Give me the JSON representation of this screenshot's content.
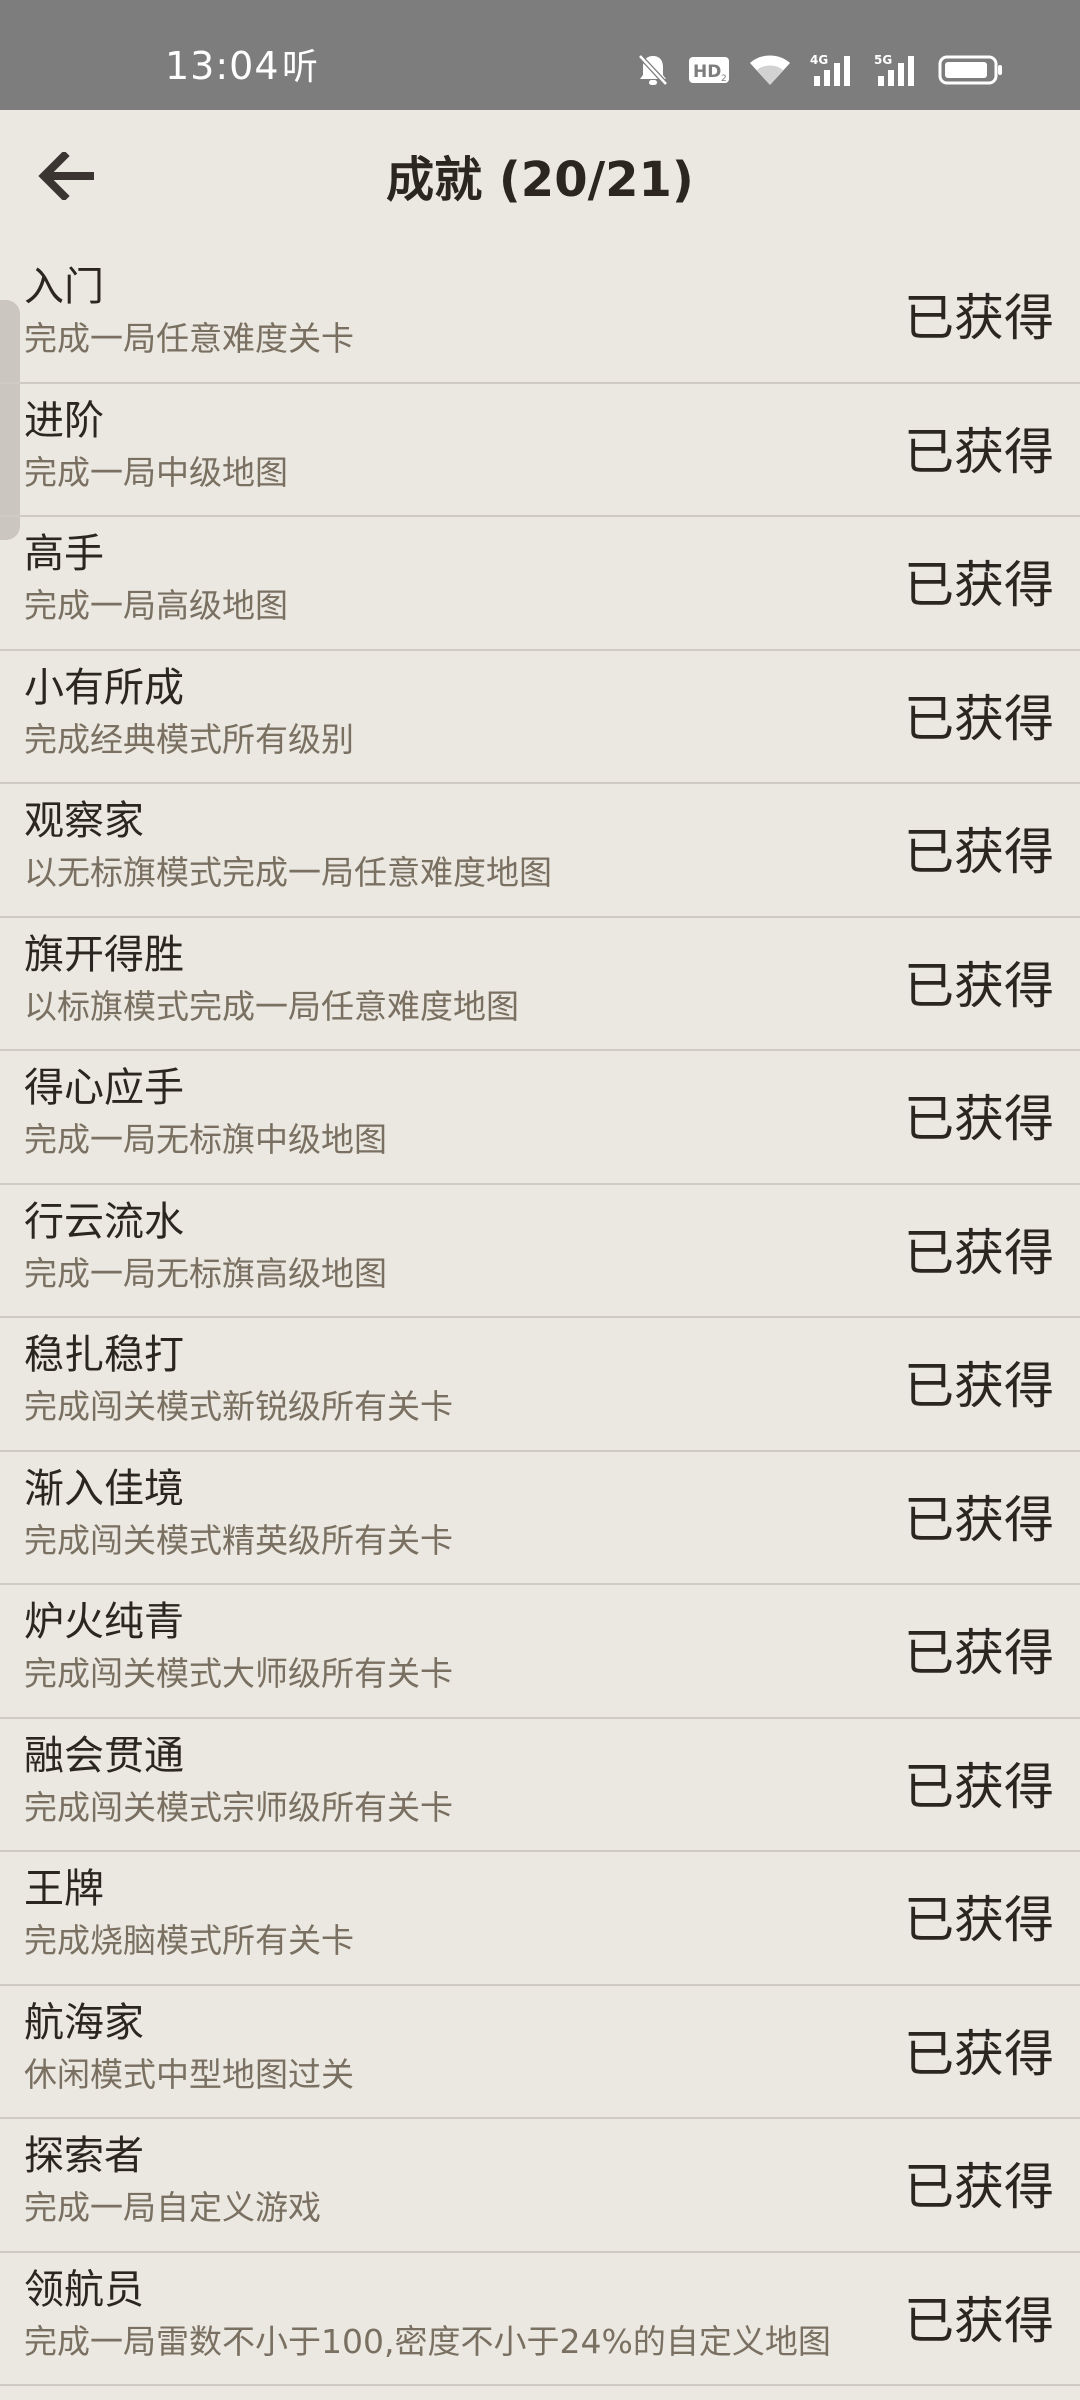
{
  "status_bar": {
    "time": "13:04",
    "extra": "听",
    "icons": [
      "bell-muted-icon",
      "hd-icon",
      "wifi-icon",
      "4g-signal-icon",
      "5g-signal-icon",
      "battery-icon"
    ]
  },
  "header": {
    "back_icon": "arrow-left-icon",
    "title": "成就 (20/21)"
  },
  "achievements": [
    {
      "name": "入门",
      "desc": "完成一局任意难度关卡",
      "status": "已获得"
    },
    {
      "name": "进阶",
      "desc": "完成一局中级地图",
      "status": "已获得"
    },
    {
      "name": "高手",
      "desc": "完成一局高级地图",
      "status": "已获得"
    },
    {
      "name": "小有所成",
      "desc": "完成经典模式所有级别",
      "status": "已获得"
    },
    {
      "name": "观察家",
      "desc": "以无标旗模式完成一局任意难度地图",
      "status": "已获得"
    },
    {
      "name": "旗开得胜",
      "desc": "以标旗模式完成一局任意难度地图",
      "status": "已获得"
    },
    {
      "name": "得心应手",
      "desc": "完成一局无标旗中级地图",
      "status": "已获得"
    },
    {
      "name": "行云流水",
      "desc": "完成一局无标旗高级地图",
      "status": "已获得"
    },
    {
      "name": "稳扎稳打",
      "desc": "完成闯关模式新锐级所有关卡",
      "status": "已获得"
    },
    {
      "name": "渐入佳境",
      "desc": "完成闯关模式精英级所有关卡",
      "status": "已获得"
    },
    {
      "name": "炉火纯青",
      "desc": "完成闯关模式大师级所有关卡",
      "status": "已获得"
    },
    {
      "name": "融会贯通",
      "desc": "完成闯关模式宗师级所有关卡",
      "status": "已获得"
    },
    {
      "name": "王牌",
      "desc": "完成烧脑模式所有关卡",
      "status": "已获得"
    },
    {
      "name": "航海家",
      "desc": "休闲模式中型地图过关",
      "status": "已获得"
    },
    {
      "name": "探索者",
      "desc": "完成一局自定义游戏",
      "status": "已获得"
    },
    {
      "name": "领航员",
      "desc": "完成一局雷数不小于100,密度不小于24%的自定义地图",
      "status": "已获得"
    }
  ],
  "colors": {
    "background": "#ebe8e2",
    "status_bar": "#7d7d7d",
    "text_primary": "#2b2620",
    "text_secondary": "#7a7061",
    "divider": "#cfcbc4"
  }
}
